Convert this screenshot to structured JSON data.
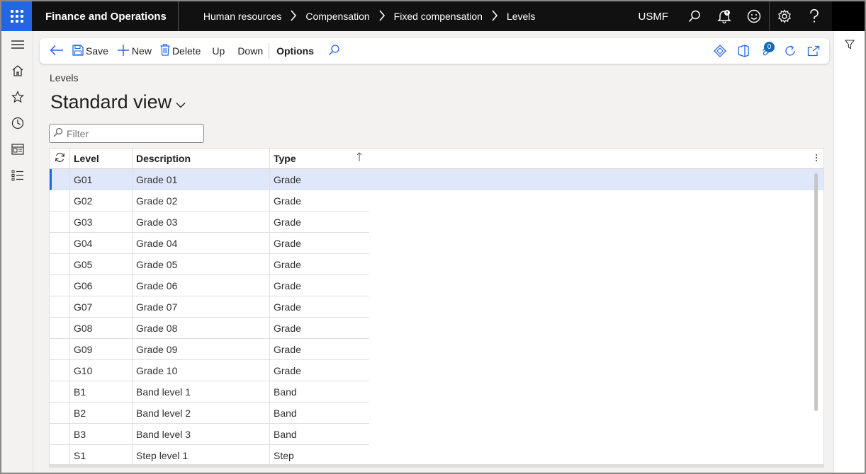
{
  "app": {
    "title": "Finance and Operations",
    "company": "USMF"
  },
  "breadcrumb": [
    "Human resources",
    "Compensation",
    "Fixed compensation",
    "Levels"
  ],
  "actions": {
    "save": "Save",
    "new": "New",
    "delete": "Delete",
    "up": "Up",
    "down": "Down",
    "options": "Options",
    "attachments_count": "0"
  },
  "page": {
    "caption": "Levels",
    "view_name": "Standard view",
    "filter_placeholder": "Filter"
  },
  "grid": {
    "columns": [
      "Level",
      "Description",
      "Type"
    ],
    "rows": [
      {
        "level": "G01",
        "description": "Grade 01",
        "type": "Grade"
      },
      {
        "level": "G02",
        "description": "Grade 02",
        "type": "Grade"
      },
      {
        "level": "G03",
        "description": "Grade 03",
        "type": "Grade"
      },
      {
        "level": "G04",
        "description": "Grade 04",
        "type": "Grade"
      },
      {
        "level": "G05",
        "description": "Grade 05",
        "type": "Grade"
      },
      {
        "level": "G06",
        "description": "Grade 06",
        "type": "Grade"
      },
      {
        "level": "G07",
        "description": "Grade 07",
        "type": "Grade"
      },
      {
        "level": "G08",
        "description": "Grade 08",
        "type": "Grade"
      },
      {
        "level": "G09",
        "description": "Grade 09",
        "type": "Grade"
      },
      {
        "level": "G10",
        "description": "Grade 10",
        "type": "Grade"
      },
      {
        "level": "B1",
        "description": "Band level 1",
        "type": "Band"
      },
      {
        "level": "B2",
        "description": "Band level 2",
        "type": "Band"
      },
      {
        "level": "B3",
        "description": "Band level 3",
        "type": "Band"
      },
      {
        "level": "S1",
        "description": "Step level 1",
        "type": "Step"
      }
    ]
  },
  "colors": {
    "topbar": "#111111",
    "accent": "#2266e3",
    "selected_row": "#dfe8fb"
  }
}
